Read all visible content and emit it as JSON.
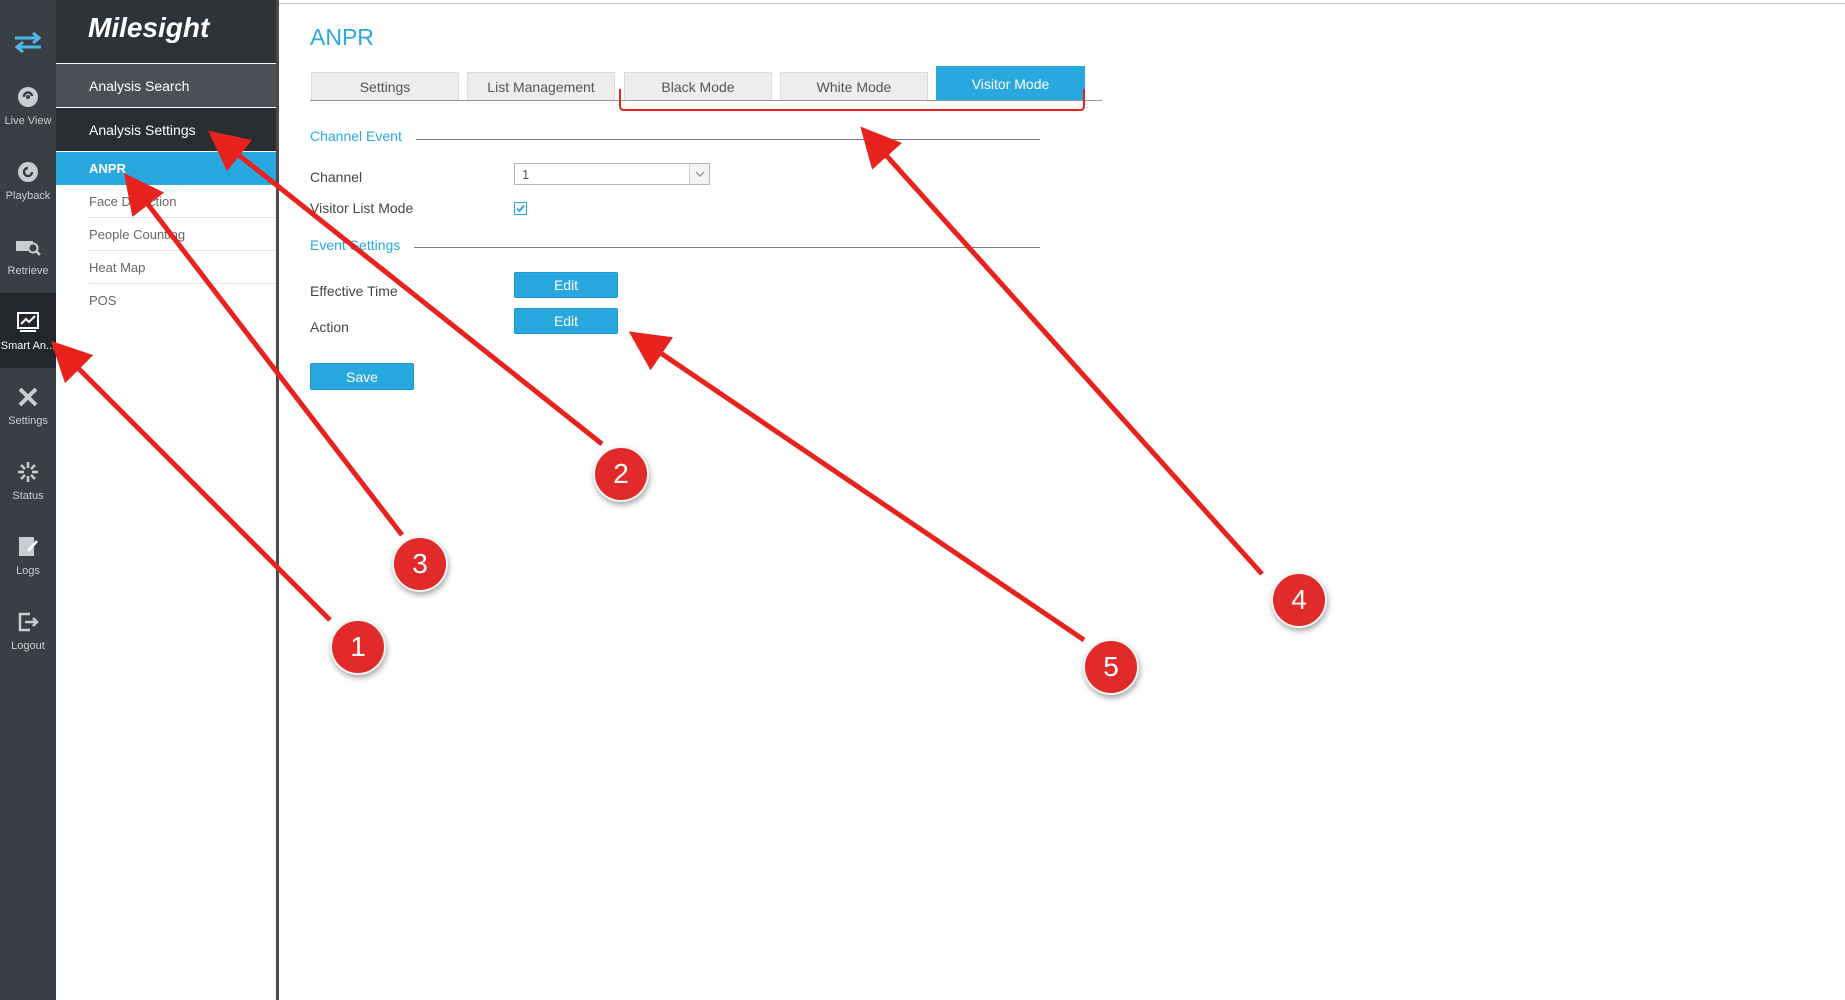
{
  "app": {
    "brand": "Milesight"
  },
  "rail": {
    "items": [
      {
        "label": "Live View",
        "icon": "live-view-icon"
      },
      {
        "label": "Playback",
        "icon": "playback-icon"
      },
      {
        "label": "Retrieve",
        "icon": "retrieve-icon"
      },
      {
        "label": "Smart An...",
        "icon": "smart-analysis-icon",
        "active": true
      },
      {
        "label": "Settings",
        "icon": "settings-icon"
      },
      {
        "label": "Status",
        "icon": "status-icon"
      },
      {
        "label": "Logs",
        "icon": "logs-icon"
      },
      {
        "label": "Logout",
        "icon": "logout-icon"
      }
    ]
  },
  "menu": {
    "analysis_search": "Analysis Search",
    "analysis_settings": "Analysis Settings",
    "items": [
      {
        "label": "ANPR",
        "active": true
      },
      {
        "label": "Face Detection"
      },
      {
        "label": "People Counting"
      },
      {
        "label": "Heat Map"
      },
      {
        "label": "POS"
      }
    ]
  },
  "page": {
    "title": "ANPR",
    "tabs": [
      {
        "label": "Settings"
      },
      {
        "label": "List Management"
      },
      {
        "label": "Black Mode"
      },
      {
        "label": "White Mode"
      },
      {
        "label": "Visitor Mode",
        "active": true
      }
    ]
  },
  "form": {
    "channel_event_title": "Channel Event",
    "channel_label": "Channel",
    "channel_value": "1",
    "visitor_list_mode_label": "Visitor List Mode",
    "visitor_list_mode_checked": true,
    "event_settings_title": "Event Settings",
    "effective_time_label": "Effective Time",
    "action_label": "Action",
    "edit_label": "Edit",
    "save_label": "Save"
  },
  "annotations": {
    "badges": [
      "1",
      "2",
      "3",
      "4",
      "5"
    ]
  },
  "colors": {
    "accent": "#29a8e0",
    "annotation": "#e12a2a",
    "rail_bg": "#3a3f45"
  }
}
